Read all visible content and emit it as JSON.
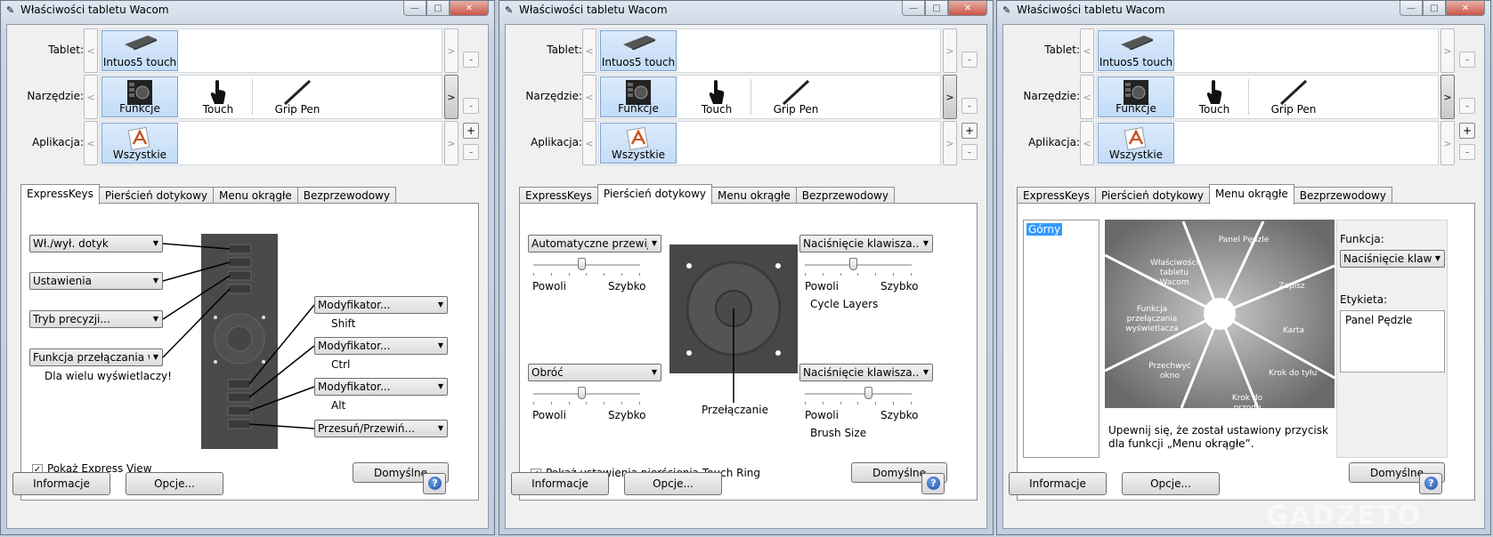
{
  "window_title": "Właściwości tabletu Wacom",
  "rows": {
    "tablet_label": "Tablet:",
    "tool_label": "Narzędzie:",
    "app_label": "Aplikacja:",
    "tablet_tile": "Intuos5 touch",
    "tool_tiles": [
      "Funkcje",
      "Touch",
      "Grip Pen"
    ],
    "app_tile": "Wszystkie",
    "left_arrow": "<",
    "right_arrow": ">",
    "plus": "+",
    "minus": "-"
  },
  "tabs": [
    "ExpressKeys",
    "Pierścień dotykowy",
    "Menu okrągłe",
    "Bezprzewodowy"
  ],
  "bottom": {
    "info_button": "Informacje",
    "options_button": "Opcje...",
    "help_symbol": "?",
    "defaults_button": "Domyślne"
  },
  "window_buttons": {
    "minimize": "—",
    "maximize": "□",
    "close": "✕"
  },
  "expresskeys": {
    "left_dropdowns": [
      "Wł./wył. dotyk",
      "Ustawienia",
      "Tryb precyzji...",
      "Funkcja przełączania wyśw"
    ],
    "left_caption": "Dla wielu wyświetlaczy!",
    "right_dropdowns": [
      "Modyfikator...",
      "Modyfikator...",
      "Modyfikator...",
      "Przesuń/Przewiń..."
    ],
    "right_captions": [
      "Shift",
      "Ctrl",
      "Alt"
    ],
    "checkbox_label": "Pokaż Express View",
    "checkbox_checked": "✓"
  },
  "touchring": {
    "top_left_dropdown": "Automatyczne przewijanie",
    "top_right_dropdown": "Naciśnięcie klawisza...",
    "bottom_left_dropdown": "Obróć",
    "bottom_right_dropdown": "Naciśnięcie klawisza...",
    "slow": "Powoli",
    "fast": "Szybko",
    "top_right_caption": "Cycle Layers",
    "bottom_right_caption": "Brush Size",
    "center_caption": "Przełączanie",
    "checkbox_label": "Pokaż ustawienia pierścienia Touch Ring",
    "checkbox_checked": "✓",
    "slider_levels": [
      0.45,
      0.45,
      0.45,
      0.6
    ]
  },
  "radial": {
    "list_item": "Górny",
    "slices": [
      "Panel Pędzle",
      "Zapisz",
      "Karta",
      "Krok do tyłu",
      "Krok do przodu",
      "Przechwyć okno",
      "Funkcja przełączania wyświetlacza",
      "Właściwości tabletu Wacom"
    ],
    "function_label": "Funkcja:",
    "function_value": "Naciśnięcie klawisza",
    "label_label": "Etykieta:",
    "label_value": "Panel Pędzle",
    "note": "Upewnij się, że został ustawiony przycisk dla funkcji „Menu okrągłe”."
  },
  "watermark": "GADZETO"
}
